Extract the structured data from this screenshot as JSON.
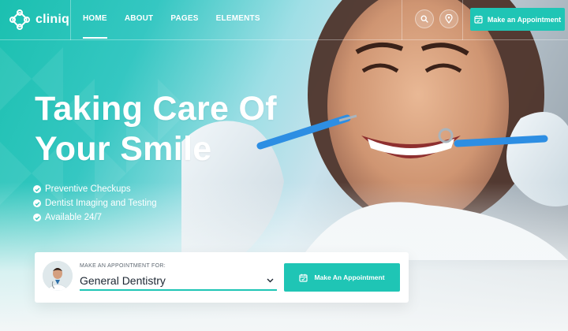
{
  "brand": {
    "name": "cliniq",
    "accent": "#1fc5b5"
  },
  "nav": {
    "items": [
      {
        "label": "HOME",
        "active": true
      },
      {
        "label": "ABOUT",
        "active": false
      },
      {
        "label": "PAGES",
        "active": false
      },
      {
        "label": "ELEMENTS",
        "active": false
      }
    ],
    "search_icon": "search-icon",
    "location_icon": "location-pin-icon",
    "cta_label": "Make an Appointment",
    "cta_icon": "calendar-icon"
  },
  "hero": {
    "headline_line1": "Taking Care Of",
    "headline_line2": "Your Smile",
    "features": [
      "Preventive Checkups",
      "Dentist Imaging and Testing",
      "Available 24/7"
    ]
  },
  "booking": {
    "label": "MAKE AN APPOINTMENT FOR:",
    "selected": "General Dentistry",
    "button_label": "Make An Appointment",
    "button_icon": "calendar-icon"
  }
}
